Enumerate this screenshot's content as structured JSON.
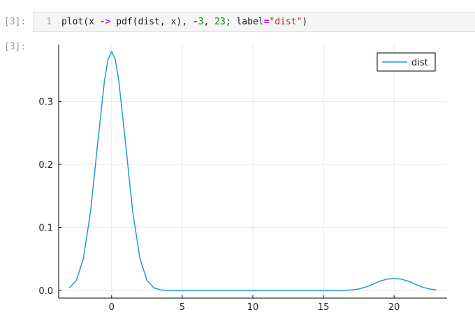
{
  "notebook": {
    "input_prompt": "[3]:",
    "output_prompt": "[3]:",
    "line_number": "1",
    "code_tokens": [
      {
        "text": "plot(x ",
        "kind": "plain"
      },
      {
        "text": "->",
        "kind": "op"
      },
      {
        "text": " pdf(dist, x), ",
        "kind": "plain"
      },
      {
        "text": "-",
        "kind": "op"
      },
      {
        "text": "3",
        "kind": "num"
      },
      {
        "text": ", ",
        "kind": "plain"
      },
      {
        "text": "23",
        "kind": "num"
      },
      {
        "text": "; label",
        "kind": "plain"
      },
      {
        "text": "=",
        "kind": "op"
      },
      {
        "text": "\"dist\"",
        "kind": "str"
      },
      {
        "text": ")",
        "kind": "plain"
      }
    ]
  },
  "chart_data": {
    "type": "line",
    "title": "",
    "xlabel": "",
    "ylabel": "",
    "xlim": [
      -3.75,
      23.75
    ],
    "ylim": [
      -0.012,
      0.39
    ],
    "xticks": [
      0,
      5,
      10,
      15,
      20
    ],
    "yticks": [
      0.0,
      0.1,
      0.2,
      0.3
    ],
    "ytick_labels": [
      "0.0",
      "0.1",
      "0.2",
      "0.3"
    ],
    "grid": true,
    "legend": "top-right",
    "series": [
      {
        "name": "dist",
        "color": "#1f9ad6",
        "points": [
          [
            -3,
            0.004
          ],
          [
            -2.5,
            0.016
          ],
          [
            -2,
            0.051
          ],
          [
            -1.5,
            0.124
          ],
          [
            -1,
            0.231
          ],
          [
            -0.5,
            0.334
          ],
          [
            -0.25,
            0.367
          ],
          [
            0,
            0.379
          ],
          [
            0.25,
            0.367
          ],
          [
            0.5,
            0.334
          ],
          [
            1,
            0.231
          ],
          [
            1.5,
            0.124
          ],
          [
            2,
            0.051
          ],
          [
            2.5,
            0.016
          ],
          [
            3,
            0.004
          ],
          [
            3.5,
            0.001
          ],
          [
            4,
            0.0
          ],
          [
            5,
            0.0
          ],
          [
            8,
            0.0
          ],
          [
            12,
            0.0
          ],
          [
            16,
            0.0
          ],
          [
            16.5,
            0.0005
          ],
          [
            17,
            0.001
          ],
          [
            17.5,
            0.0025
          ],
          [
            18,
            0.0055
          ],
          [
            18.5,
            0.01
          ],
          [
            19,
            0.015
          ],
          [
            19.5,
            0.018
          ],
          [
            20,
            0.019
          ],
          [
            20.5,
            0.018
          ],
          [
            21,
            0.015
          ],
          [
            21.5,
            0.01
          ],
          [
            22,
            0.0055
          ],
          [
            22.5,
            0.0025
          ],
          [
            23,
            0.001
          ]
        ]
      }
    ]
  }
}
